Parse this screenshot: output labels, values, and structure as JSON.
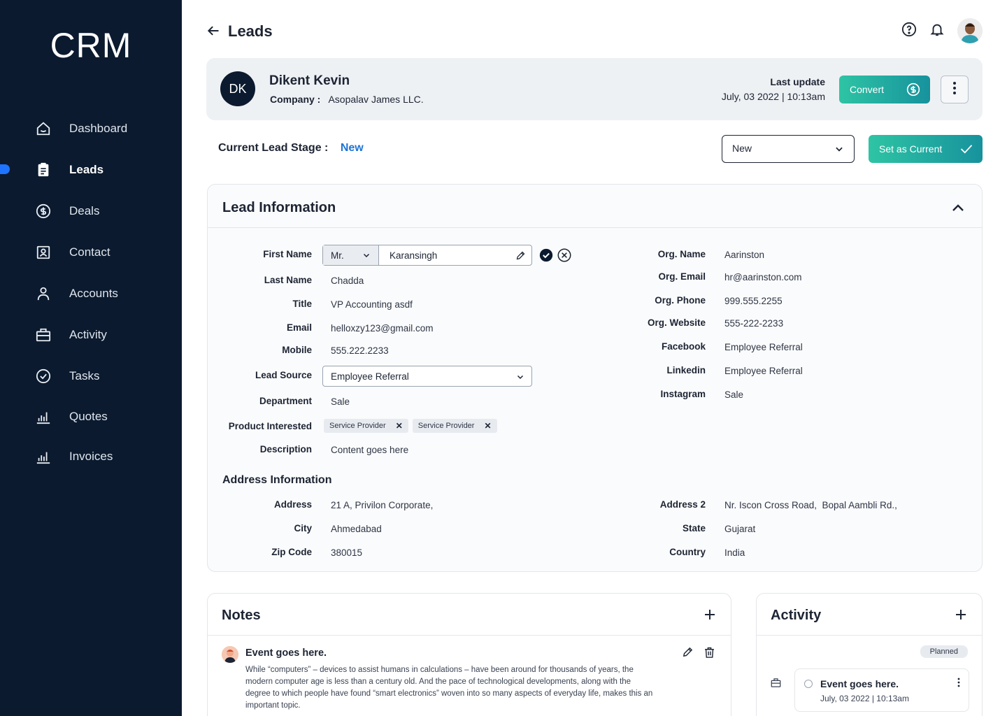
{
  "app": {
    "logo": "CRM"
  },
  "sidebar": {
    "items": [
      {
        "label": "Dashboard",
        "icon": "home-icon",
        "active": false
      },
      {
        "label": "Leads",
        "icon": "clipboard-icon",
        "active": true
      },
      {
        "label": "Deals",
        "icon": "dollar-circle-icon",
        "active": false
      },
      {
        "label": "Contact",
        "icon": "contact-card-icon",
        "active": false
      },
      {
        "label": "Accounts",
        "icon": "user-icon",
        "active": false
      },
      {
        "label": "Activity",
        "icon": "briefcase-icon",
        "active": false
      },
      {
        "label": "Tasks",
        "icon": "check-circle-icon",
        "active": false
      },
      {
        "label": "Quotes",
        "icon": "bar-chart-icon",
        "active": false
      },
      {
        "label": "Invoices",
        "icon": "bar-chart-icon",
        "active": false
      }
    ]
  },
  "header": {
    "title": "Leads"
  },
  "lead": {
    "initials": "DK",
    "name": "Dikent Kevin",
    "company_label": "Company :",
    "company": "Asopalav James LLC.",
    "last_update_label": "Last update",
    "last_update": "July, 03 2022 | 10:13am",
    "convert_label": "Convert"
  },
  "stage": {
    "label": "Current Lead Stage :",
    "value": "New",
    "select_value": "New",
    "set_label": "Set as Current"
  },
  "lead_info": {
    "title": "Lead Information",
    "left": {
      "first_name_label": "First Name",
      "salutation": "Mr.",
      "first_name": "Karansingh",
      "last_name_label": "Last Name",
      "last_name": "Chadda",
      "title_label": "Title",
      "title": "VP Accounting asdf",
      "email_label": "Email",
      "email": "helloxzy123@gmail.com",
      "mobile_label": "Mobile",
      "mobile": "555.222.2233",
      "lead_source_label": "Lead Source",
      "lead_source": "Employee Referral",
      "department_label": "Department",
      "department": "Sale",
      "product_label": "Product Interested",
      "products": [
        "Service Provider",
        "Service Provider"
      ],
      "description_label": "Description",
      "description": "Content goes here"
    },
    "right": {
      "org_name_label": "Org. Name",
      "org_name": "Aarinston",
      "org_email_label": "Org. Email",
      "org_email": "hr@aarinston.com",
      "org_phone_label": "Org. Phone",
      "org_phone": "999.555.2255",
      "org_website_label": "Org. Website",
      "org_website": "555-222-2233",
      "facebook_label": "Facebook",
      "facebook": "Employee Referral",
      "linkedin_label": "Linkedin",
      "linkedin": "Employee Referral",
      "instagram_label": "Instagram",
      "instagram": "Sale"
    },
    "address": {
      "title": "Address Information",
      "address_label": "Address",
      "address": "21 A, Privilon Corporate,",
      "city_label": "City",
      "city": "Ahmedabad",
      "zip_label": "Zip Code",
      "zip": "380015",
      "address2_label": "Address 2",
      "address2": "Nr. Iscon Cross Road,  Bopal Aambli Rd.,",
      "state_label": "State",
      "state": "Gujarat",
      "country_label": "Country",
      "country": "India"
    }
  },
  "notes": {
    "title": "Notes",
    "item": {
      "title": "Event goes here.",
      "body": "While “computers” – devices to assist humans in calculations – have been around for thousands of years, the modern computer age is less than a century old. And the pace of technological developments, along with the degree to which people have found “smart electronics” woven into so many aspects of everyday life, makes this an important topic."
    }
  },
  "activity": {
    "title": "Activity",
    "badge": "Planned",
    "item": {
      "title": "Event goes here.",
      "date": "July, 03 2022 | 10:13am"
    }
  },
  "colors": {
    "sidebar": "#0b1a2e",
    "accent": "#1e74d6",
    "button_gradient_start": "#2ec4a4",
    "button_gradient_end": "#17929d"
  }
}
